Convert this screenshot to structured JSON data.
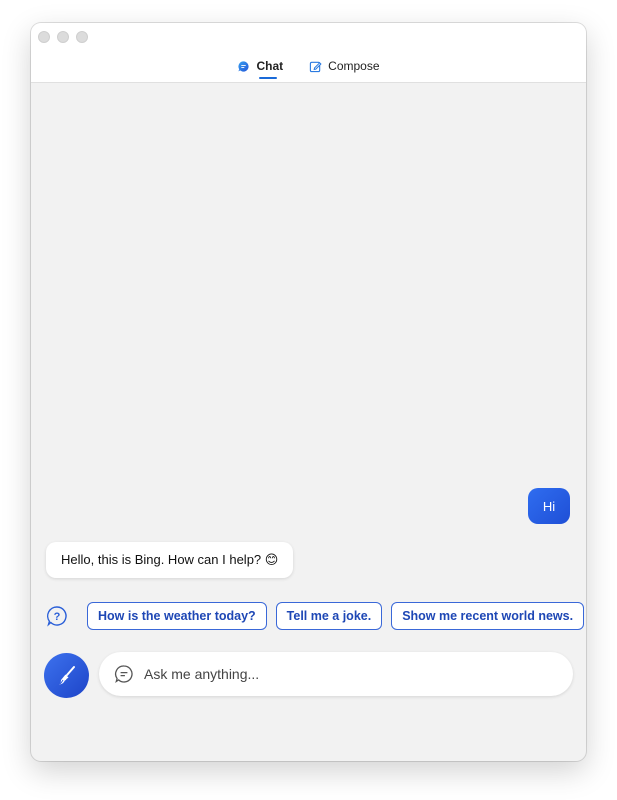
{
  "tabs": [
    {
      "label": "Chat",
      "icon": "chat-bubble-icon",
      "active": true
    },
    {
      "label": "Compose",
      "icon": "compose-icon",
      "active": false
    }
  ],
  "conversation": {
    "user_message": "Hi",
    "bot_message": "Hello, this is Bing. How can I help? 😊"
  },
  "suggestions": [
    "How is the weather today?",
    "Tell me a joke.",
    "Show me recent world news."
  ],
  "input": {
    "placeholder": "Ask me anything..."
  },
  "colors": {
    "accent": "#2563eb",
    "chip_text": "#1e47b5",
    "background": "#f2f2f2"
  }
}
